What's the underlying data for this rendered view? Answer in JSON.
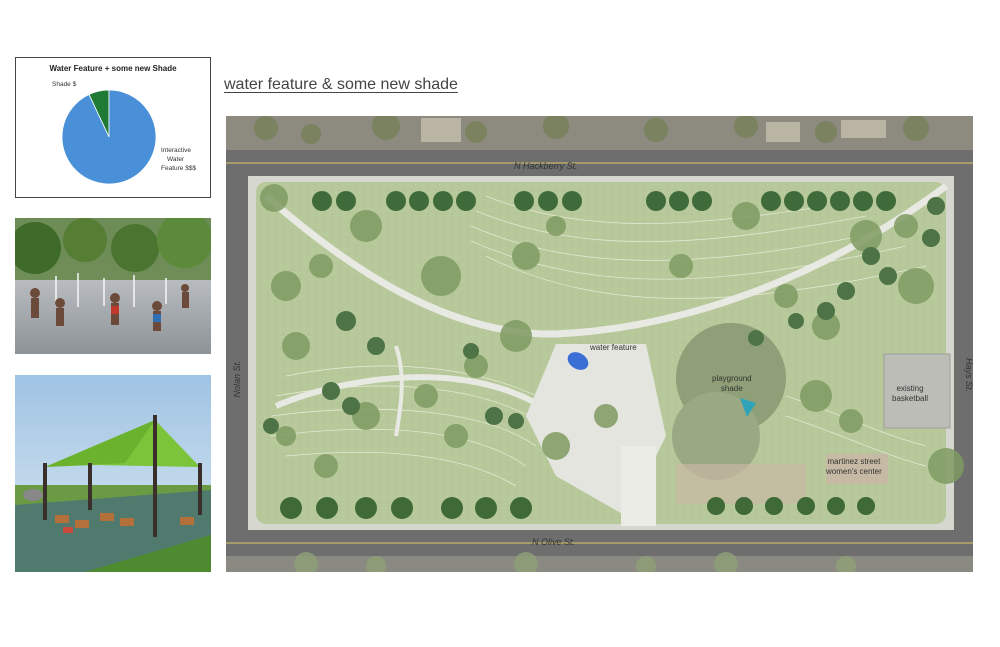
{
  "heading": "water feature & some new shade",
  "chart_data": {
    "type": "pie",
    "title": "Water Feature + some new Shade",
    "slices": [
      {
        "label": "Shade $",
        "value": 7,
        "color": "#1e7a34"
      },
      {
        "label": "Interactive Water Feature $$$",
        "value": 93,
        "color": "#4a90d9"
      }
    ]
  },
  "pie_labels": {
    "shade": "Shade $",
    "water_line1": "Interactive",
    "water_line2": "Water",
    "water_line3": "Feature $$$"
  },
  "plan": {
    "streets": {
      "north": "N Hackberry St.",
      "south": "N Olive St.",
      "west": "Nolan St.",
      "east": "Hays St."
    },
    "labels": {
      "water_feature": "water feature",
      "playground_line1": "playground",
      "playground_line2": "shade",
      "basketball_line1": "existing",
      "basketball_line2": "basketball",
      "center_line1": "martinez street",
      "center_line2": "women's center"
    }
  },
  "photos": {
    "splash_pad": "splash-pad-photo",
    "shade_sail": "shade-sail-photo"
  }
}
